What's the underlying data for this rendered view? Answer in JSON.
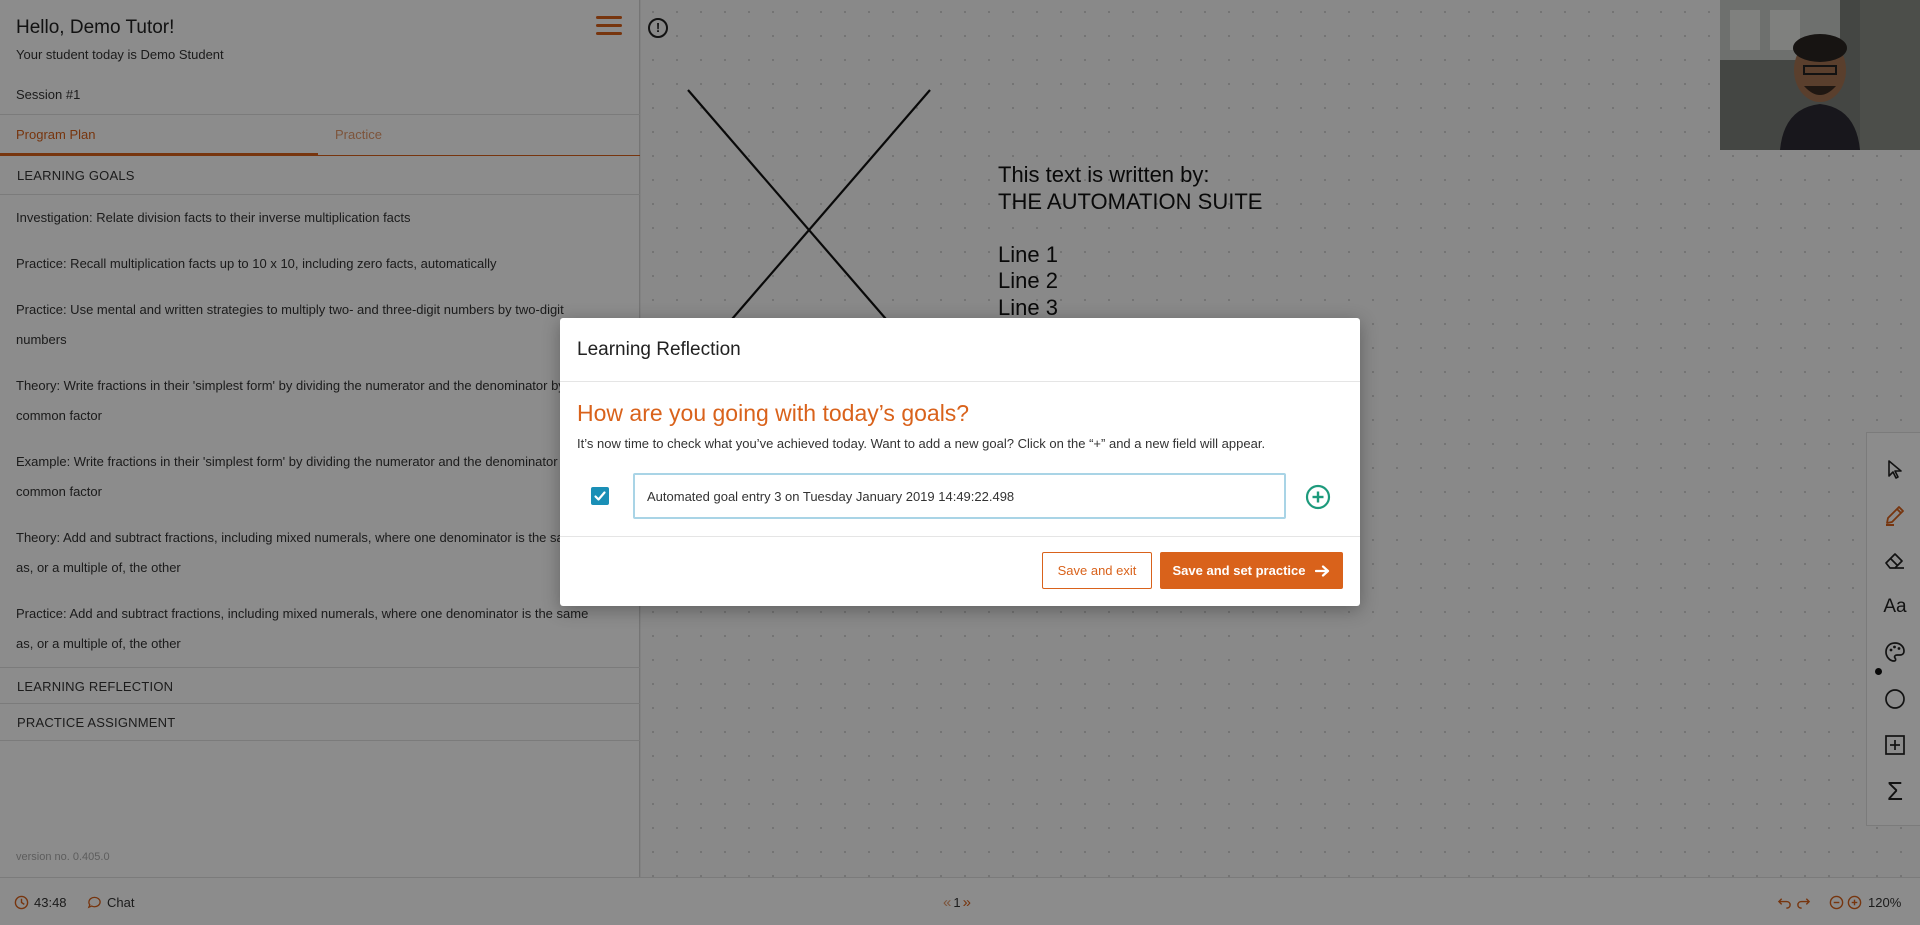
{
  "sidebar": {
    "greeting": "Hello, Demo Tutor!",
    "student_line": "Your student today is Demo Student",
    "session": "Session #1",
    "tabs": [
      "Program Plan",
      "Practice"
    ],
    "learning_goals_header": "LEARNING GOALS",
    "goals": [
      [
        "Investigation: Relate division facts to their inverse multiplication facts"
      ],
      [
        "Practice: Recall multiplication facts up to 10 x 10, including zero facts, automatically"
      ],
      [
        "Practice: Use mental and written strategies to multiply two- and three-digit numbers by two-digit",
        "numbers"
      ],
      [
        "Theory: Write fractions in their 'simplest form' by dividing the numerator and the denominator by a",
        "common factor"
      ],
      [
        "Example: Write fractions in their 'simplest form' by dividing the numerator and the denominator by a",
        "common factor"
      ],
      [
        "Theory: Add and subtract fractions, including mixed numerals, where one denominator is the same",
        "as, or a multiple of, the other"
      ],
      [
        "Practice: Add and subtract fractions, including mixed numerals, where one denominator is the same",
        "as, or a multiple of, the other"
      ]
    ],
    "learning_reflection_header": "LEARNING REFLECTION",
    "practice_assignment_header": "PRACTICE ASSIGNMENT",
    "version": "version no. 0.405.0"
  },
  "canvas": {
    "text_lines": [
      "This text is written by:",
      "THE AUTOMATION SUITE",
      "",
      "Line 1",
      "Line 2",
      "Line 3"
    ]
  },
  "bottom_bar": {
    "timer": "43:48",
    "chat": "Chat",
    "page_prev": "«",
    "page_number": "1",
    "page_next": "»",
    "zoom": "120%"
  },
  "modal": {
    "title": "Learning Reflection",
    "question": "How are you going with today’s goals?",
    "description": "It’s now time to check what you’ve achieved today. Want to add a new goal? Click on the “+” and a new field will appear.",
    "goal_entry": "Automated goal entry 3 on Tuesday January 2019 14:49:22.498",
    "goal_checked": true,
    "save_exit_label": "Save and exit",
    "save_practice_label": "Save and set practice"
  },
  "toolbar": {
    "tools": [
      "pointer-icon",
      "pencil-icon",
      "eraser-icon",
      "text-icon",
      "palette-icon",
      "circle-icon",
      "add-box-icon",
      "sigma-icon"
    ],
    "text_tool_label": "Aa",
    "sigma_label": "Σ"
  },
  "colors": {
    "accent": "#d9621b",
    "checkbox": "#1a8fb6",
    "add_goal": "#1d9a7c",
    "input_border": "#a9d4e6"
  }
}
